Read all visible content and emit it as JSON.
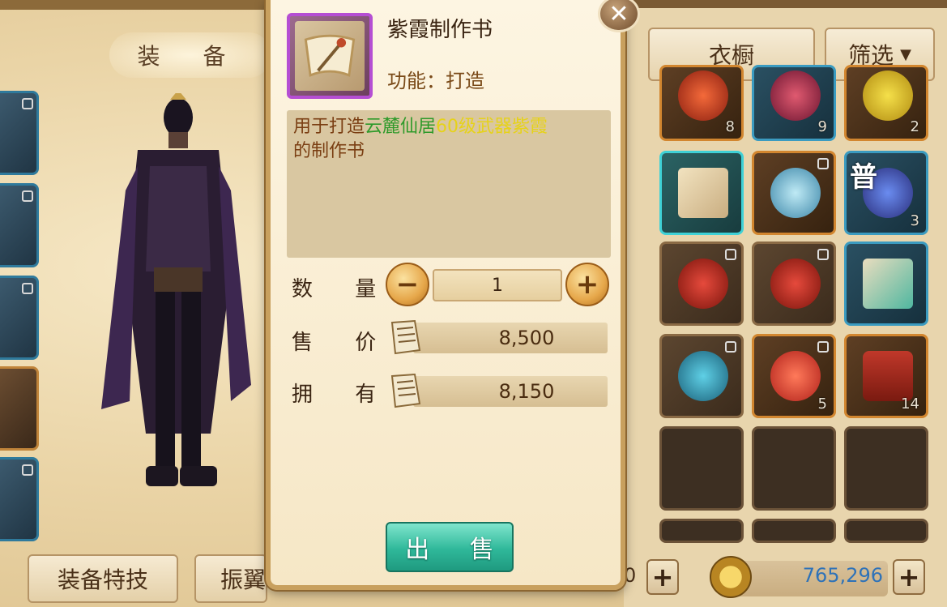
{
  "background": {
    "equip_tab_label": "装 备",
    "bottom_buttons": [
      "装备特技",
      "振翼"
    ],
    "top_buttons": {
      "wardrobe": "衣橱",
      "filter": "筛选"
    },
    "grid_counts": [
      "8",
      "9",
      "2",
      "3",
      "5",
      "14"
    ],
    "grid_badge": "普",
    "currency_left_value": "0",
    "currency_value": "765,296"
  },
  "popup": {
    "item_name": "紫霞制作书",
    "function_label": "功能：打造",
    "description": {
      "part1": "用于打造",
      "highlight_green": "云麓仙居",
      "highlight_yellow": "60级武器紫霞",
      "part2": "的制作书"
    },
    "quantity_label": "数 量",
    "quantity_value": "1",
    "price_label": "售 价",
    "price_value": "8,500",
    "owned_label": "拥 有",
    "owned_value": "8,150",
    "sell_button": "出 售",
    "minus_label": "−",
    "plus_label": "+",
    "close_label": "✕"
  },
  "colors": {
    "rarity_purple": "#b54ed3",
    "sell_button": "#2fb89a",
    "desc_green": "#2e9a2a",
    "desc_yellow": "#e6d21a",
    "currency_blue": "#2e72b8"
  },
  "icons": [
    "scroll-icon",
    "close-icon",
    "minus-icon",
    "plus-icon",
    "coin-icon",
    "lock-icon"
  ]
}
